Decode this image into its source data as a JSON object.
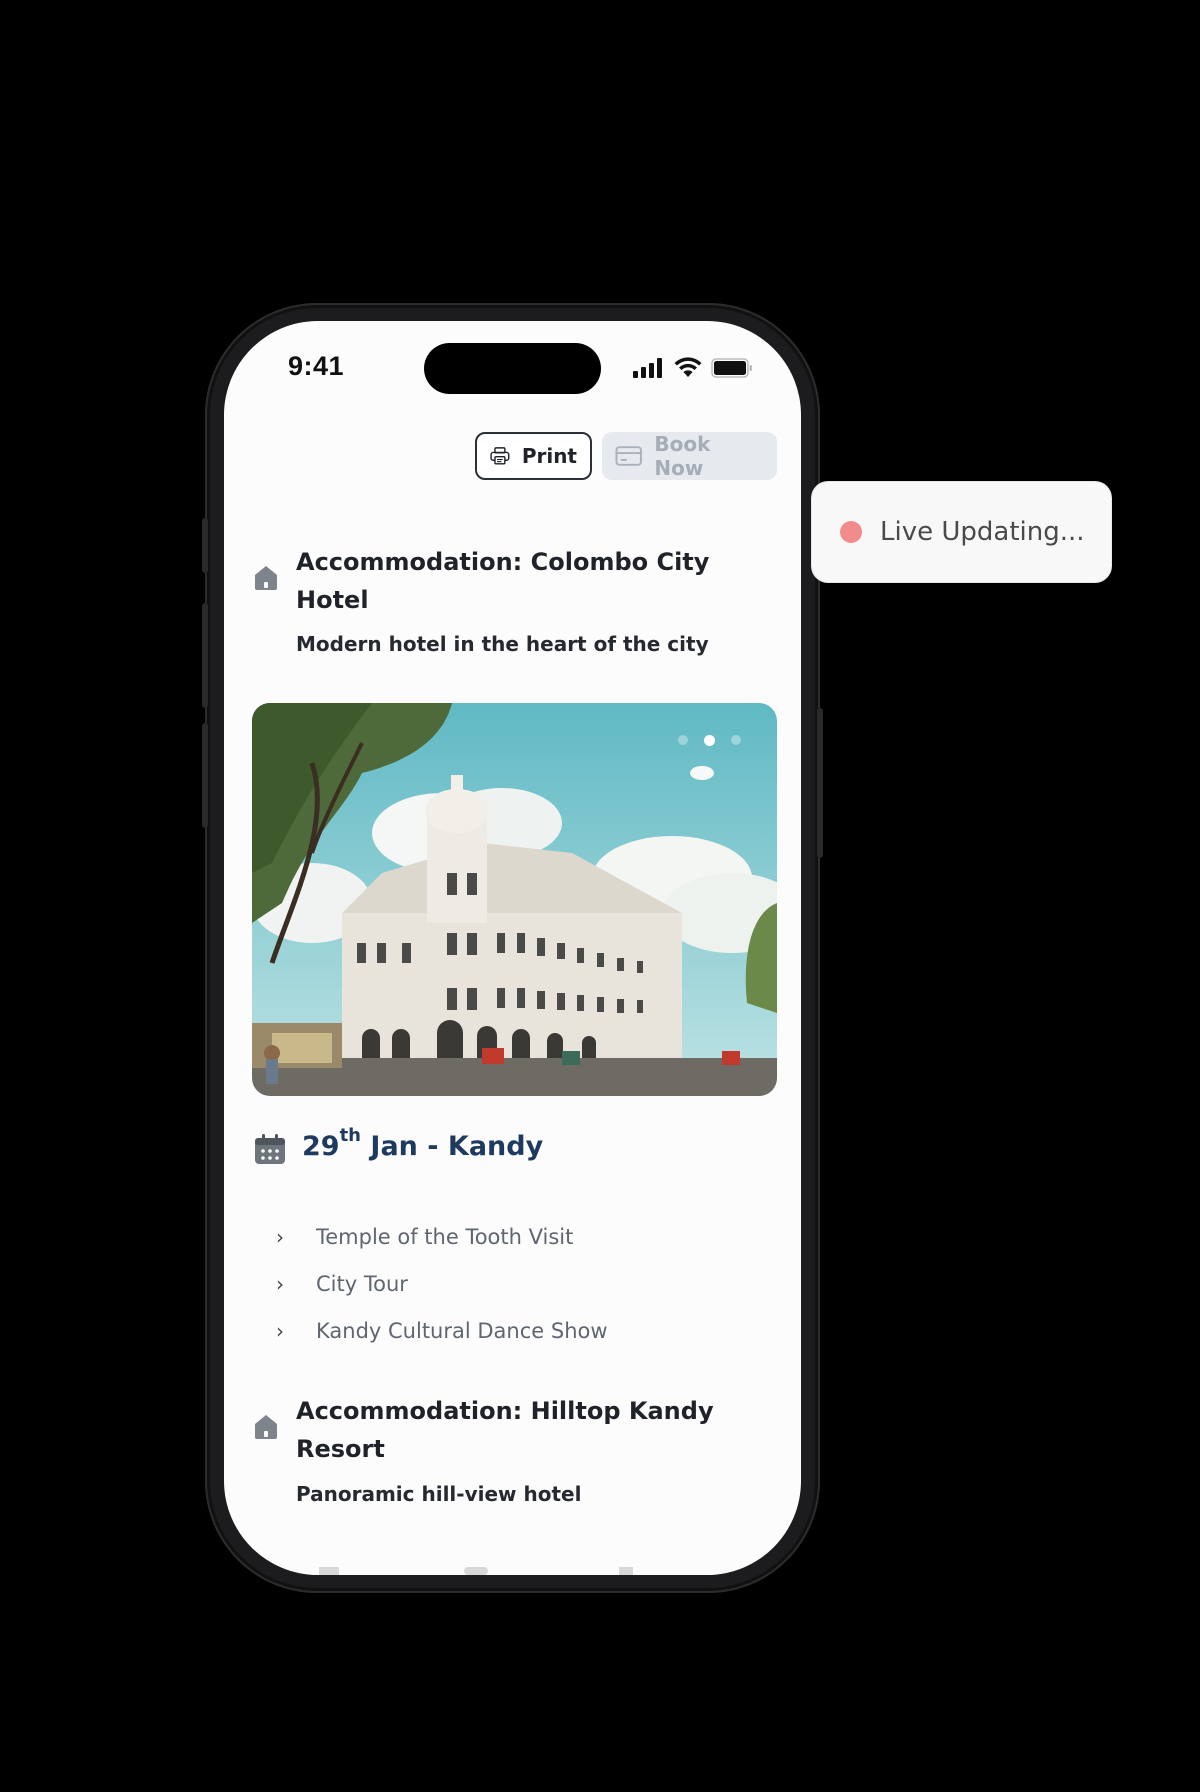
{
  "status_bar": {
    "time": "9:41"
  },
  "toolbar": {
    "print_label": "Print",
    "book_label": "Book Now"
  },
  "accommodation_1": {
    "title_line1": "Accommodation: Colombo City",
    "title_line2": "Hotel",
    "subtitle": "Modern hotel in the heart of the city"
  },
  "carousel": {
    "active_index": 1,
    "total": 3
  },
  "day": {
    "date_num": "29",
    "date_suffix": "th",
    "date_rest": " Jan - Kandy"
  },
  "activities": [
    "Temple of the Tooth Visit",
    "City Tour",
    "Kandy Cultural Dance Show"
  ],
  "accommodation_2": {
    "title_line1": "Accommodation: Hilltop Kandy",
    "title_line2": "Resort",
    "subtitle": "Panoramic hill-view hotel"
  },
  "live_status": {
    "label": "Live Updating...",
    "dot_color": "#f28b8b"
  },
  "colors": {
    "heading": "#1e3a5f",
    "text": "#1f2329"
  }
}
